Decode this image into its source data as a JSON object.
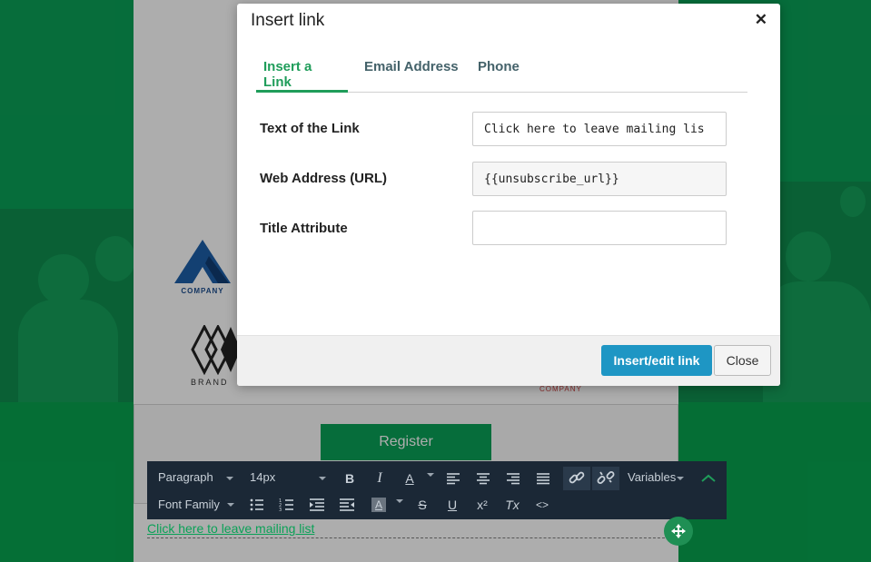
{
  "dialog": {
    "title": "Insert link",
    "close_glyph": "✕",
    "tabs": [
      {
        "label": "Insert a Link"
      },
      {
        "label": "Email Address"
      },
      {
        "label": "Phone"
      }
    ],
    "fields": {
      "link_text_label": "Text of the Link",
      "link_text_value": "Click here to leave mailing lis",
      "url_label": "Web Address (URL)",
      "url_value": "{{unsubscribe_url}}",
      "title_label": "Title Attribute",
      "title_value": ""
    },
    "insert_button": "Insert/edit link",
    "close_button": "Close"
  },
  "background": {
    "register_button": "Register",
    "logo1_text": "COMPANY",
    "logo2_text": "BRAND",
    "logo3_text": "COMPANY"
  },
  "toolbar": {
    "paragraph_label": "Paragraph",
    "font_size_label": "14px",
    "variables_label": "Variables",
    "font_family_label": "Font Family",
    "bold_glyph": "B",
    "italic_glyph": "I",
    "text_color_glyph": "A",
    "strikethrough_glyph": "S",
    "underline_glyph": "U",
    "superscript_glyph": "x²",
    "clear_format_glyph": "Tx",
    "code_glyph": "<>",
    "icons": [
      "bold-icon",
      "italic-icon",
      "text-color-icon",
      "align-left-icon",
      "align-center-icon",
      "align-right-icon",
      "align-justify-icon",
      "link-icon",
      "unlink-icon",
      "collapse-icon",
      "bullet-list-icon",
      "numbered-list-icon",
      "indent-icon",
      "outdent-icon",
      "background-color-icon",
      "strikethrough-icon",
      "underline-icon",
      "superscript-icon",
      "clear-format-icon",
      "code-icon"
    ]
  },
  "editor": {
    "link_text": "Click here to leave mailing list"
  },
  "colors": {
    "brand_green": "#0aa157",
    "primary_button": "#1e96c4",
    "toolbar_bg": "#1b2836"
  }
}
